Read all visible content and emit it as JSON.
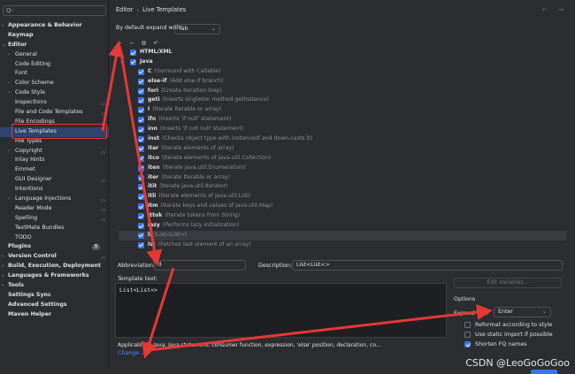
{
  "sidebar": {
    "search_icon": "Q-",
    "items": [
      {
        "label": "Appearance & Behavior",
        "bold": true,
        "chev": "›",
        "indent": 0
      },
      {
        "label": "Keymap",
        "bold": true,
        "indent": 0
      },
      {
        "label": "Editor",
        "bold": true,
        "chev": "⌄",
        "indent": 0
      },
      {
        "label": "General",
        "chev": "›",
        "indent": 1
      },
      {
        "label": "Code Editing",
        "indent": 1
      },
      {
        "label": "Font",
        "indent": 1
      },
      {
        "label": "Color Scheme",
        "chev": "›",
        "indent": 1
      },
      {
        "label": "Code Style",
        "chev": "›",
        "indent": 1
      },
      {
        "label": "Inspections",
        "indent": 1,
        "badge": "▭"
      },
      {
        "label": "File and Code Templates",
        "indent": 1,
        "badge": "▭"
      },
      {
        "label": "File Encodings",
        "indent": 1,
        "badge": "▭"
      },
      {
        "label": "Live Templates",
        "indent": 1,
        "selected": true
      },
      {
        "label": "File Types",
        "indent": 1
      },
      {
        "label": "Copyright",
        "chev": "›",
        "indent": 1,
        "badge": "▭"
      },
      {
        "label": "Inlay Hints",
        "indent": 1
      },
      {
        "label": "Emmet",
        "indent": 1
      },
      {
        "label": "GUI Designer",
        "indent": 1,
        "badge": "▭"
      },
      {
        "label": "Intentions",
        "indent": 1
      },
      {
        "label": "Language Injections",
        "chev": "›",
        "indent": 1,
        "badge": "▭"
      },
      {
        "label": "Reader Mode",
        "indent": 1,
        "badge": "▭"
      },
      {
        "label": "Spelling",
        "indent": 1,
        "badge": "▭"
      },
      {
        "label": "TextMate Bundles",
        "indent": 1
      },
      {
        "label": "TODO",
        "indent": 1
      },
      {
        "label": "Plugins",
        "bold": true,
        "indent": 0,
        "count": "5"
      },
      {
        "label": "Version Control",
        "bold": true,
        "chev": "›",
        "indent": 0,
        "badge": "▭"
      },
      {
        "label": "Build, Execution, Deployment",
        "bold": true,
        "chev": "›",
        "indent": 0
      },
      {
        "label": "Languages & Frameworks",
        "bold": true,
        "chev": "›",
        "indent": 0
      },
      {
        "label": "Tools",
        "bold": true,
        "chev": "›",
        "indent": 0
      },
      {
        "label": "Settings Sync",
        "bold": true,
        "indent": 0
      },
      {
        "label": "Advanced Settings",
        "bold": true,
        "indent": 0
      },
      {
        "label": "Maven Helper",
        "bold": true,
        "indent": 0
      }
    ]
  },
  "header": {
    "crumb1": "Editor",
    "sep": "›",
    "crumb2": "Live Templates",
    "nav": "← →"
  },
  "expand": {
    "label": "By default expand with",
    "value": "Tab",
    "dd": "⌄"
  },
  "toolbar": {
    "icons": "+ − ⧉ ↶"
  },
  "templates": [
    {
      "type": "group",
      "name": "HTML/XML",
      "chev": "›",
      "indent": 0
    },
    {
      "type": "group",
      "name": "Java",
      "chev": "⌄",
      "indent": 0
    },
    {
      "type": "item",
      "name": "C",
      "desc": "(Surround with Callable)"
    },
    {
      "type": "item",
      "name": "else-if",
      "desc": "(Add else-if branch)"
    },
    {
      "type": "item",
      "name": "fori",
      "desc": "(Create iteration loop)"
    },
    {
      "type": "item",
      "name": "geti",
      "desc": "(Inserts singleton method getInstance)"
    },
    {
      "type": "item",
      "name": "I",
      "desc": "(Iterate Iterable or array)"
    },
    {
      "type": "item",
      "name": "ifn",
      "desc": "(Inserts 'if null' statement)"
    },
    {
      "type": "item",
      "name": "inn",
      "desc": "(Inserts 'if not null' statement)"
    },
    {
      "type": "item",
      "name": "inst",
      "desc": "(Checks object type with instanceof and down-casts it)"
    },
    {
      "type": "item",
      "name": "itar",
      "desc": "(Iterate elements of array)"
    },
    {
      "type": "item",
      "name": "itco",
      "desc": "(Iterate elements of java.util.Collection)"
    },
    {
      "type": "item",
      "name": "iten",
      "desc": "(Iterate java.util.Enumeration)"
    },
    {
      "type": "item",
      "name": "iter",
      "desc": "(Iterate Iterable or array)"
    },
    {
      "type": "item",
      "name": "itit",
      "desc": "(Iterate java.util.Iterator)"
    },
    {
      "type": "item",
      "name": "itli",
      "desc": "(Iterate elements of java.util.List)"
    },
    {
      "type": "item",
      "name": "itm",
      "desc": "(Iterate keys and values of java.util.Map)"
    },
    {
      "type": "item",
      "name": "ittok",
      "desc": "(Iterate tokens from String)"
    },
    {
      "type": "item",
      "name": "lazy",
      "desc": "(Performs lazy initialization)"
    },
    {
      "type": "item",
      "name": "ll",
      "desc": "(List<List>)",
      "selected": true
    },
    {
      "type": "item",
      "name": "lst",
      "desc": "(Fetches last element of an array)"
    }
  ],
  "editor": {
    "abbr_label": "Abbreviation:",
    "abbr_value": "ll",
    "desc_label": "Description:",
    "desc_value": "List<List<>",
    "template_label": "Template text:",
    "template_text": "List<List<>",
    "edit_variables": "Edit Variables...",
    "options_title": "Options",
    "expand_label": "Expand with",
    "expand_value": "Enter",
    "reformat": "Reformat according to style",
    "static_import": "Use static import if possible",
    "shorten_fq": "Shorten FQ names",
    "applicable": "Applicable in Java: Java statement, consumer function, expression, 'else' position, declaration, co...",
    "change": "Change ⌄"
  },
  "watermark": "CSDN @LeoGoGoGoo",
  "colors": {
    "accent": "#3574f0",
    "selection": "#2e436e",
    "annotation": "#e53935"
  }
}
